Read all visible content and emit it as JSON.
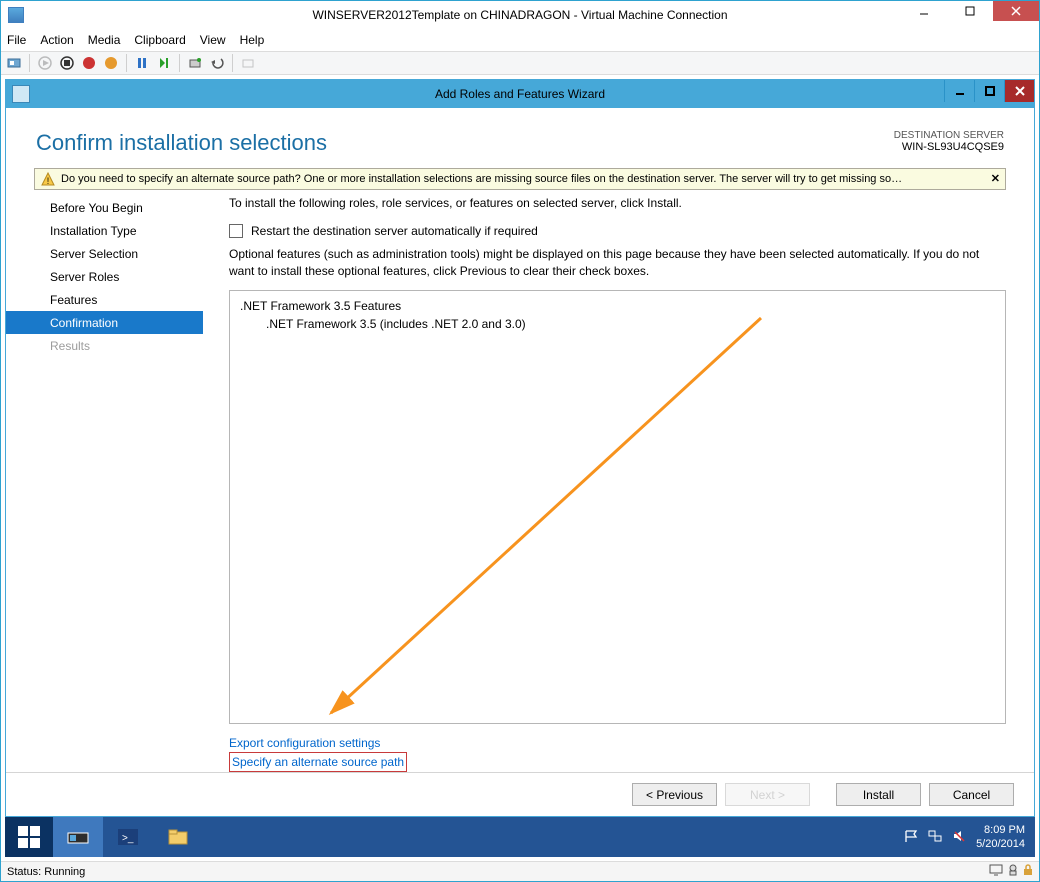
{
  "vm": {
    "title": "WINSERVER2012Template on CHINADRAGON - Virtual Machine Connection",
    "menu": {
      "file": "File",
      "action": "Action",
      "media": "Media",
      "clipboard": "Clipboard",
      "view": "View",
      "help": "Help"
    }
  },
  "wizard": {
    "title": "Add Roles and Features Wizard",
    "heading": "Confirm installation selections",
    "destination_label": "DESTINATION SERVER",
    "destination_name": "WIN-SL93U4CQSE9",
    "warning": "Do you need to specify an alternate source path? One or more installation selections are missing source files on the destination server. The server will try to get missing so…",
    "sidebar": [
      "Before You Begin",
      "Installation Type",
      "Server Selection",
      "Server Roles",
      "Features",
      "Confirmation",
      "Results"
    ],
    "content": {
      "instr": "To install the following roles, role services, or features on selected server, click Install.",
      "restart_label": "Restart the destination server automatically if required",
      "note": "Optional features (such as administration tools) might be displayed on this page because they have been selected automatically. If you do not want to install these optional features, click Previous to clear their check boxes.",
      "feature_group": ".NET Framework 3.5 Features",
      "feature_item": ".NET Framework 3.5 (includes .NET 2.0 and 3.0)",
      "link_export": "Export configuration settings",
      "link_altpath": "Specify an alternate source path"
    },
    "buttons": {
      "previous": "< Previous",
      "next": "Next >",
      "install": "Install",
      "cancel": "Cancel"
    }
  },
  "tray": {
    "time": "8:09 PM",
    "date": "5/20/2014"
  },
  "statusbar": {
    "text": "Status: Running"
  }
}
